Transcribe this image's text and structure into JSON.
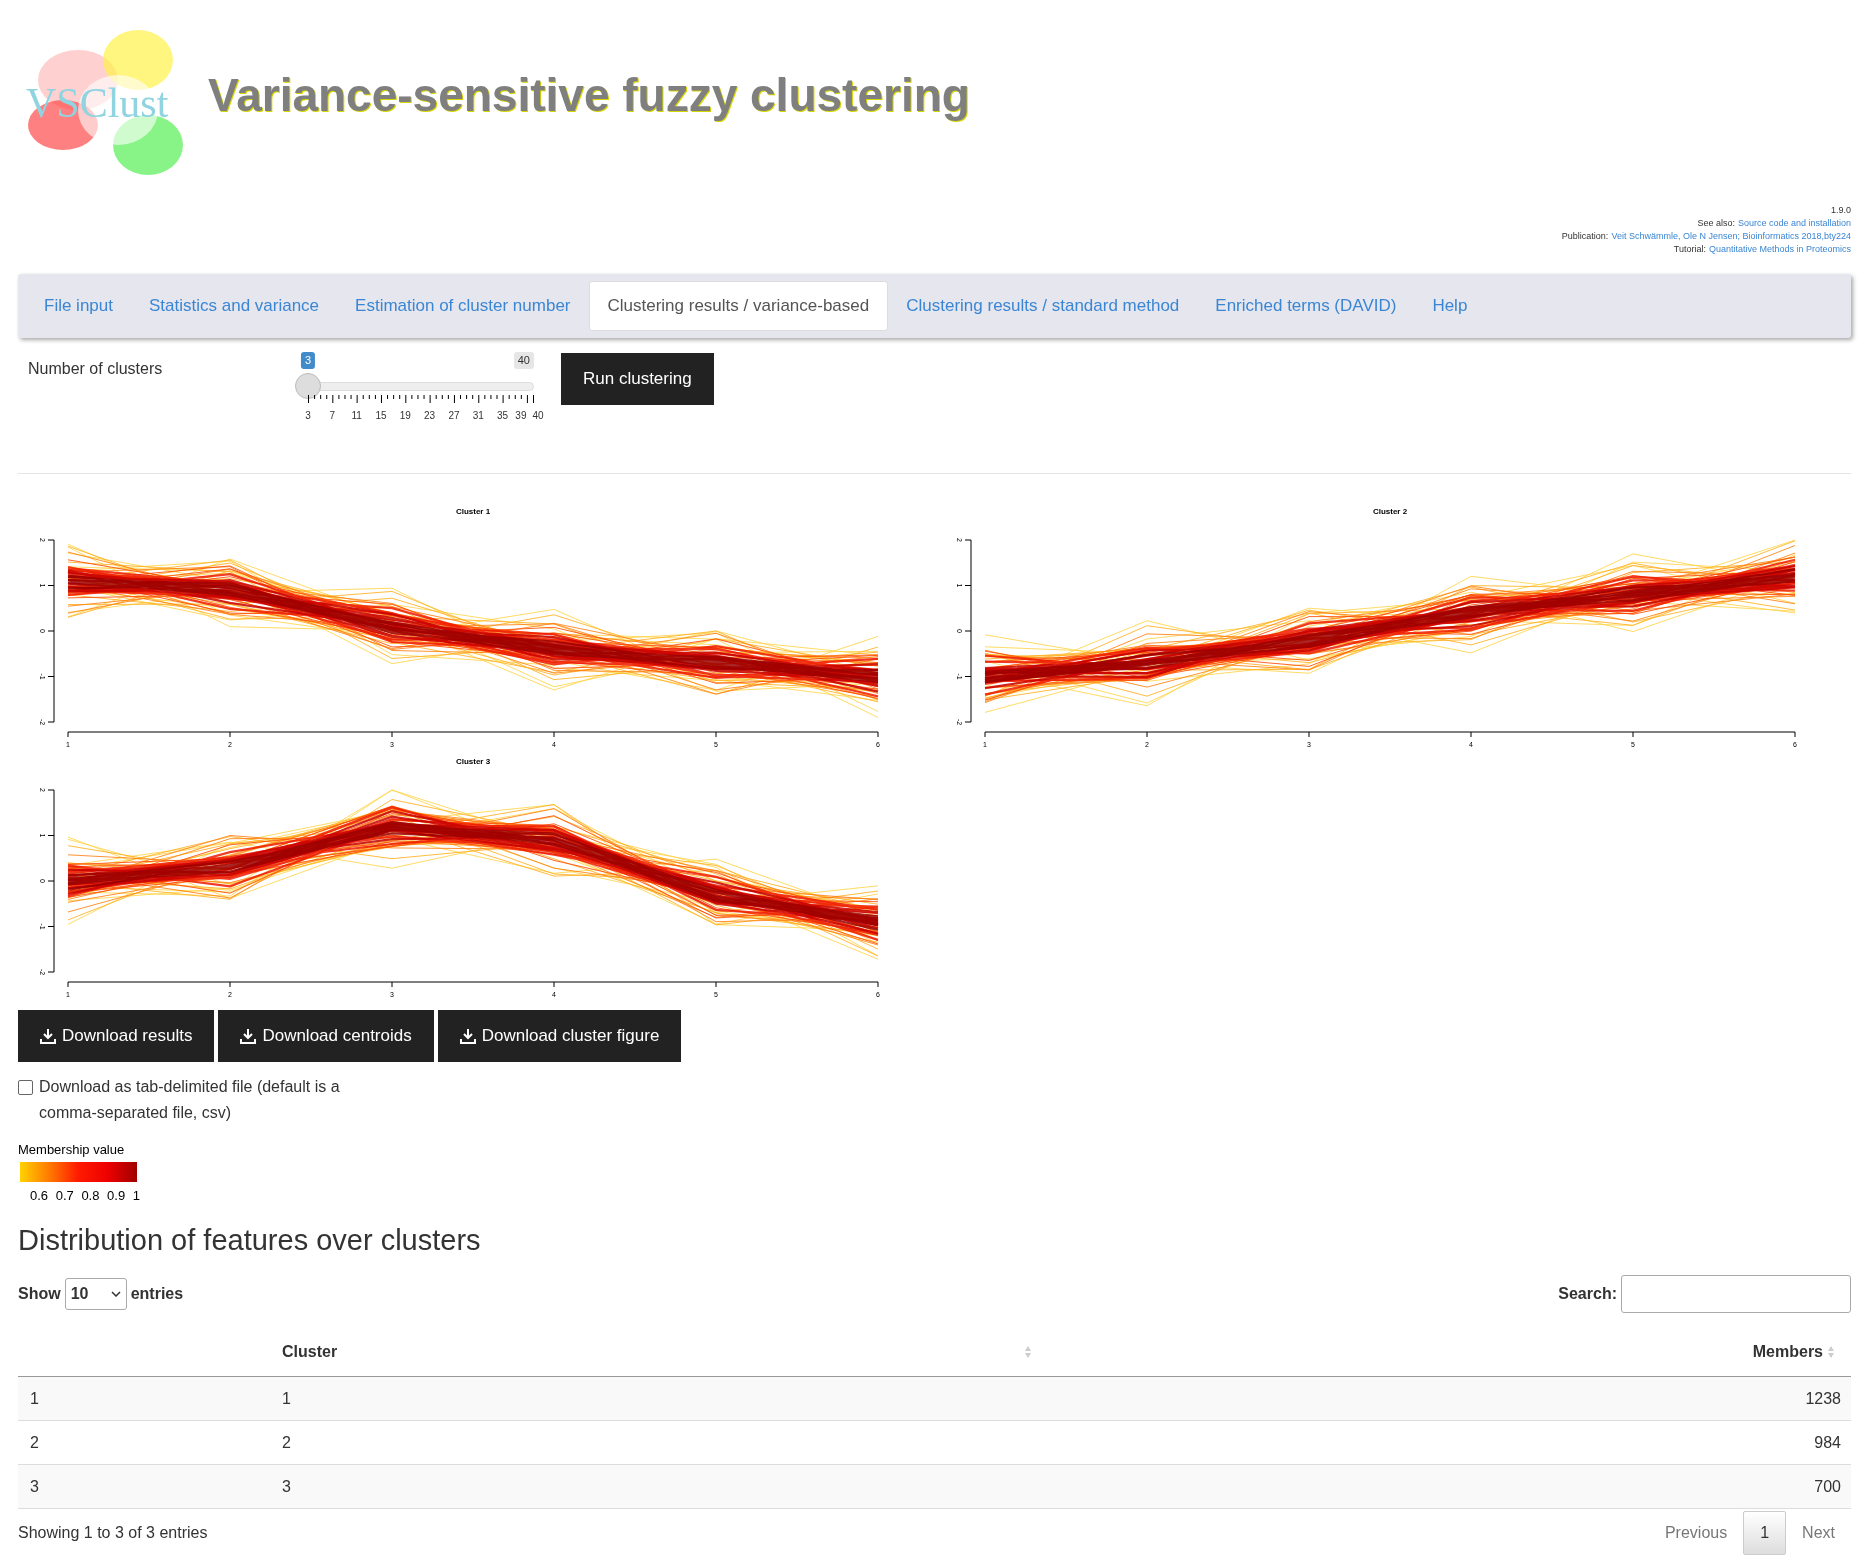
{
  "header": {
    "logo_text": "VSClust",
    "title": "Variance-sensitive fuzzy clustering"
  },
  "info": {
    "version": "1.9.0",
    "lines": [
      {
        "label": "See also:",
        "link": "Source code and installation"
      },
      {
        "label": "Publication:",
        "link": "Veit Schwämmle, Ole N Jensen; Bioinformatics 2018,bty224"
      },
      {
        "label": "Tutorial:",
        "link": "Quantitative Methods in Proteomics"
      }
    ]
  },
  "tabs": [
    {
      "label": "File input",
      "selected": false
    },
    {
      "label": "Statistics and variance",
      "selected": false
    },
    {
      "label": "Estimation of cluster number",
      "selected": false
    },
    {
      "label": "Clustering results / variance-based",
      "selected": true
    },
    {
      "label": "Clustering results / standard method",
      "selected": false
    },
    {
      "label": "Enriched terms (DAVID)",
      "selected": false
    },
    {
      "label": "Help",
      "selected": false
    }
  ],
  "slider": {
    "label": "Number of clusters",
    "value": "3",
    "max": "40",
    "level": 0,
    "ticks": [
      "3",
      "7",
      "11",
      "15",
      "19",
      "23",
      "27",
      "31",
      "35",
      "39",
      "40"
    ]
  },
  "run_button": "Run clustering",
  "plots": [
    {
      "title": "Cluster 1",
      "xticks": [
        "1",
        "2",
        "3",
        "4",
        "5",
        "6"
      ],
      "yticks": [
        "2",
        "1",
        "0",
        "-1",
        "-2"
      ]
    },
    {
      "title": "Cluster 2",
      "xticks": [
        "1",
        "2",
        "3",
        "4",
        "5",
        "6"
      ],
      "yticks": [
        "2",
        "1",
        "0",
        "-1",
        "-2"
      ]
    },
    {
      "title": "Cluster 3",
      "xticks": [
        "1",
        "2",
        "3",
        "4",
        "5",
        "6"
      ],
      "yticks": [
        "2",
        "1",
        "0",
        "-1",
        "-2"
      ]
    }
  ],
  "downloads": [
    "Download results",
    "Download centroids",
    "Download cluster figure"
  ],
  "tab_delimited": {
    "label": "Download as tab-delimited file (default is a comma-separated file, csv)",
    "checked": false
  },
  "legend": {
    "title": "Membership value",
    "ticks": [
      "0.6",
      "0.7",
      "0.8",
      "0.9",
      "1"
    ]
  },
  "table": {
    "heading": "Distribution of features over clusters",
    "show": "Show",
    "length": "10",
    "entries": "entries",
    "search_label": "Search:",
    "columns": [
      "",
      "Cluster",
      "Members"
    ],
    "rows": [
      [
        "1",
        "1",
        "1238"
      ],
      [
        "2",
        "2",
        "984"
      ],
      [
        "3",
        "3",
        "700"
      ]
    ],
    "info": "Showing 1 to 3 of 3 entries",
    "previous": "Previous",
    "pages": [
      {
        "label": "1",
        "selected": true
      }
    ],
    "next": "Next"
  }
}
